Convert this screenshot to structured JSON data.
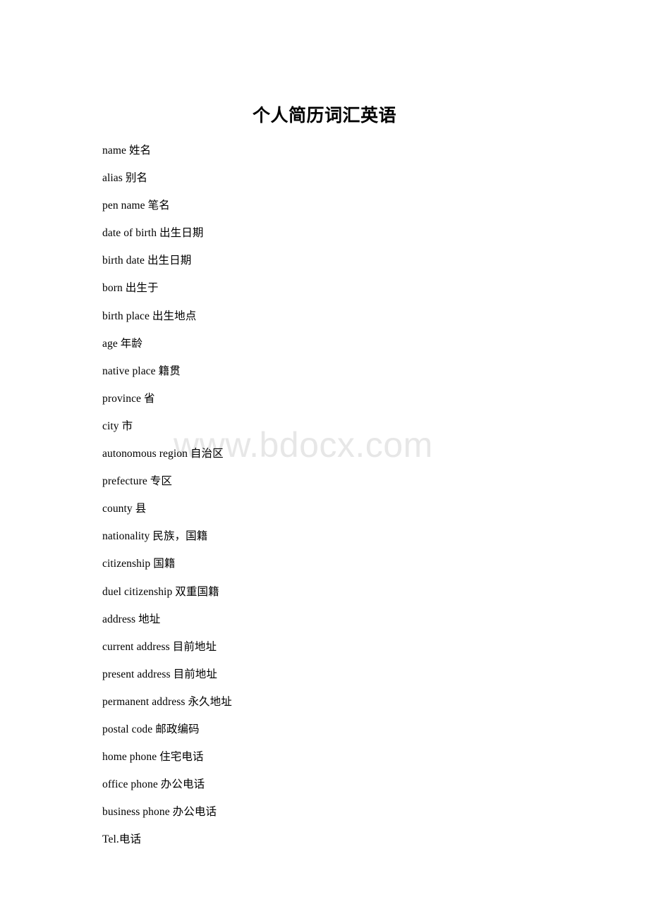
{
  "document": {
    "title": "个人简历词汇英语",
    "watermark": "www.bdocx.com",
    "watermark_color": "#e7e7e7",
    "text_color": "#000000",
    "background_color": "#ffffff",
    "entries": [
      "name 姓名",
      "alias 别名",
      "pen name 笔名",
      "date of birth 出生日期",
      "birth date 出生日期",
      "born 出生于",
      "birth place 出生地点",
      "age 年龄",
      "native place 籍贯",
      "province 省",
      "city 市",
      "autonomous region 自治区",
      "prefecture 专区",
      "county 县",
      "nationality 民族，国籍",
      "citizenship 国籍",
      "duel citizenship 双重国籍",
      "address 地址",
      "current address 目前地址",
      "present address 目前地址",
      "permanent address 永久地址",
      "postal code 邮政编码",
      "home phone 住宅电话",
      "office phone 办公电话",
      "business phone 办公电话",
      "Tel.电话"
    ]
  }
}
